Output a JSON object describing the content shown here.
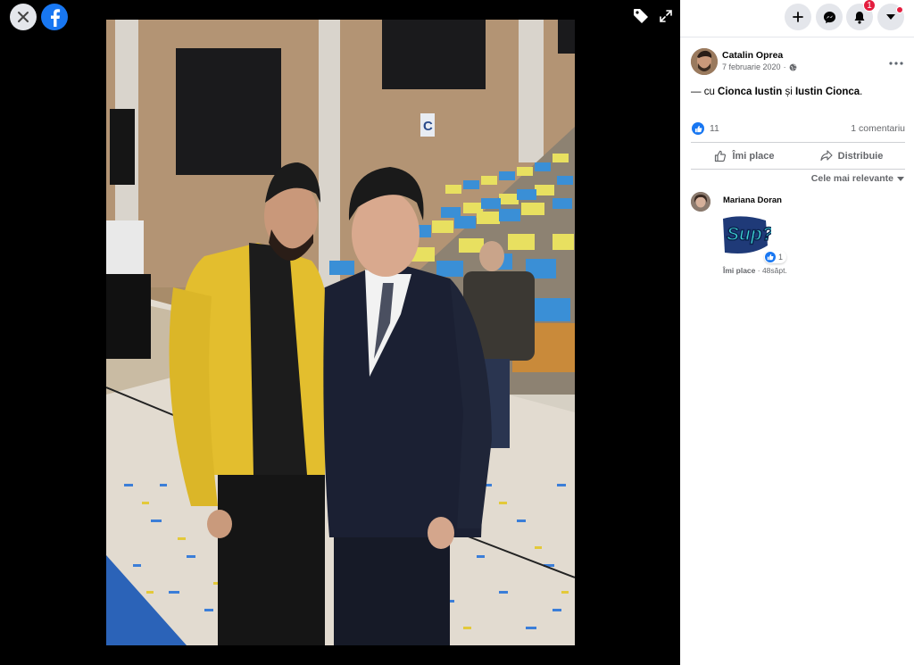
{
  "viewer": {
    "close_icon": "close-icon",
    "logo_icon": "facebook-logo",
    "tag_icon": "tag-icon",
    "expand_icon": "expand-icon"
  },
  "header": {
    "notifications_badge": "1"
  },
  "post": {
    "author": "Catalin Oprea",
    "date": "7 februarie 2020",
    "text_prefix": "— cu ",
    "tag1": "Cionca Iustin",
    "text_mid": " și ",
    "tag2": "Iustin Cionca",
    "text_suffix": ".",
    "like_count": "11",
    "comment_count": "1 comentariu",
    "like_label": "Îmi place",
    "share_label": "Distribuie",
    "sort_label": "Cele mai relevante"
  },
  "comment": {
    "author": "Mariana Doran",
    "sticker_text": "Sup?",
    "reaction_count": "1",
    "like_label": "Îmi place",
    "separator": " · ",
    "time": "48săpt."
  },
  "colors": {
    "accent": "#1877f2",
    "badge": "#e41e3f",
    "muted_text": "#65676b"
  }
}
